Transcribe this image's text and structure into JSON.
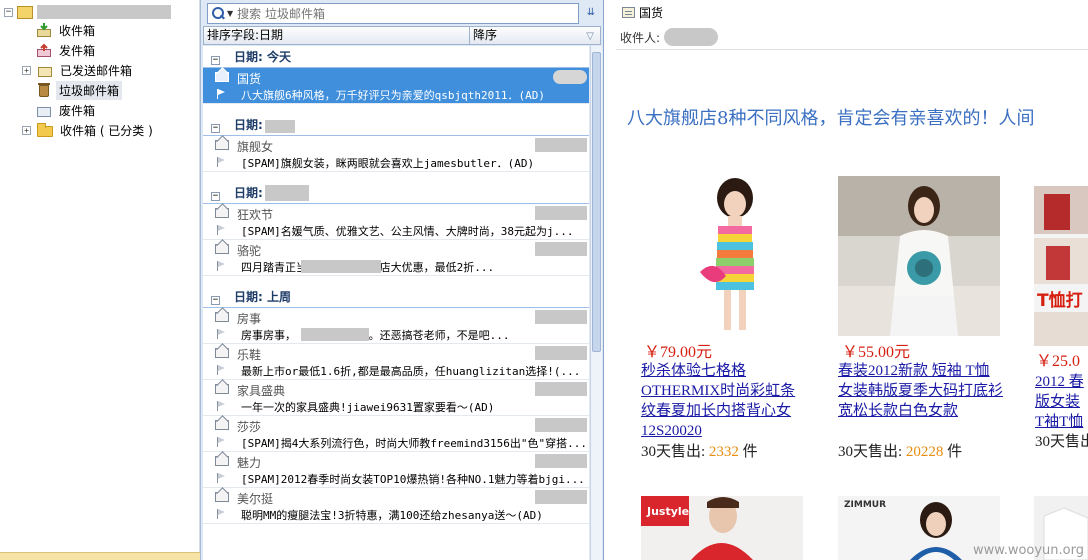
{
  "folders": {
    "items": [
      {
        "label": "收件箱",
        "icon": "inbox-icon"
      },
      {
        "label": "发件箱",
        "icon": "outbox-icon"
      },
      {
        "label": "已发送邮件箱",
        "icon": "sent-folder-icon"
      },
      {
        "label": "垃圾邮件箱",
        "icon": "junk-bin-icon"
      },
      {
        "label": "废件箱",
        "icon": "deleted-folder-icon"
      },
      {
        "label": "收件箱 ( 已分类 )",
        "icon": "folder-icon"
      }
    ],
    "expander": "+"
  },
  "search": {
    "placeholder": "搜索 垃圾邮件箱"
  },
  "sort": {
    "field_label": "排序字段:日期",
    "order_label": "降序"
  },
  "groups": [
    {
      "title": "日期: 今天",
      "toggle": "−"
    },
    {
      "title": "日期:",
      "toggle": "−"
    },
    {
      "title": "日期:",
      "toggle": "−"
    },
    {
      "title": "日期: 上周",
      "toggle": "−"
    }
  ],
  "messages": [
    {
      "sender": "国货",
      "subject": "八大旗舰6种风格，万千好评只为亲爱的qsbjqth2011．(AD)"
    },
    {
      "sender": "旗舰女",
      "subject": "[SPAM]旗舰女装，眯两眼就会喜欢上jamesbutler．(AD)"
    },
    {
      "sender": "狂欢节",
      "subject": "[SPAM]名媛气质、优雅文艺、公主风情、大牌时尚，38元起为j..."
    },
    {
      "sender": "骆驼",
      "subject": "四月踏青正当时，                官方旗舰店大优惠，最低2折..."
    },
    {
      "sender": "房事",
      "subject": "房事房事，              不可不重视哦。还恶搞苍老师，不是吧..."
    },
    {
      "sender": "乐鞋",
      "subject": "最新上市or最低1.6折,都是最高品质，任huanglizitan选择!(..."
    },
    {
      "sender": "家具盛典",
      "subject": "一年一次的家具盛典!jiawei9631置家要看～(AD)"
    },
    {
      "sender": "莎莎",
      "subject": "[SPAM]揭4大系列流行色，时尚大师教freemind3156出\"色\"穿搭..."
    },
    {
      "sender": "魅力",
      "subject": "[SPAM]2012春季时尚女装TOP10爆热销!各种NO.1魅力等着bjgi..."
    },
    {
      "sender": "美尔挺",
      "subject": "聪明MM的瘦腿法宝!3折特惠，满100还给zhesanya送～(AD)"
    }
  ],
  "reading": {
    "title": "国货",
    "recipient_label": "收件人:",
    "headline": "八大旗舰店8种不同风格，肯定会有亲喜欢的！人间"
  },
  "products": [
    {
      "price": "￥79.00元",
      "name": "秒杀体验七格格OTHERMIX时尚彩虹条纹春夏加长内搭背心女12S20020",
      "sales_prefix": "30天售出:",
      "sales_count": "2332",
      "sales_unit": "件"
    },
    {
      "price": "￥55.00元",
      "name": "春装2012新款 短袖 T恤 女装韩版夏季大码打底衫宽松长款白色女款",
      "sales_prefix": "30天售出:",
      "sales_count": "20228",
      "sales_unit": "件"
    },
    {
      "price": "￥25.0",
      "name": "2012 春版女装T袖T恤打",
      "sales_prefix": "30天售出",
      "sales_count": "",
      "sales_unit": ""
    }
  ],
  "thumb_text": {
    "brand1": "Justyle",
    "brand2": "ZIMMUR",
    "tshirt": "T恤打"
  },
  "watermark": "www.wooyun.org",
  "colors": {
    "selection": "#3f8fdc",
    "headline": "#3a6fc1",
    "price": "#d61f10",
    "sales": "#e88d0f",
    "link": "#1a1aa6"
  }
}
